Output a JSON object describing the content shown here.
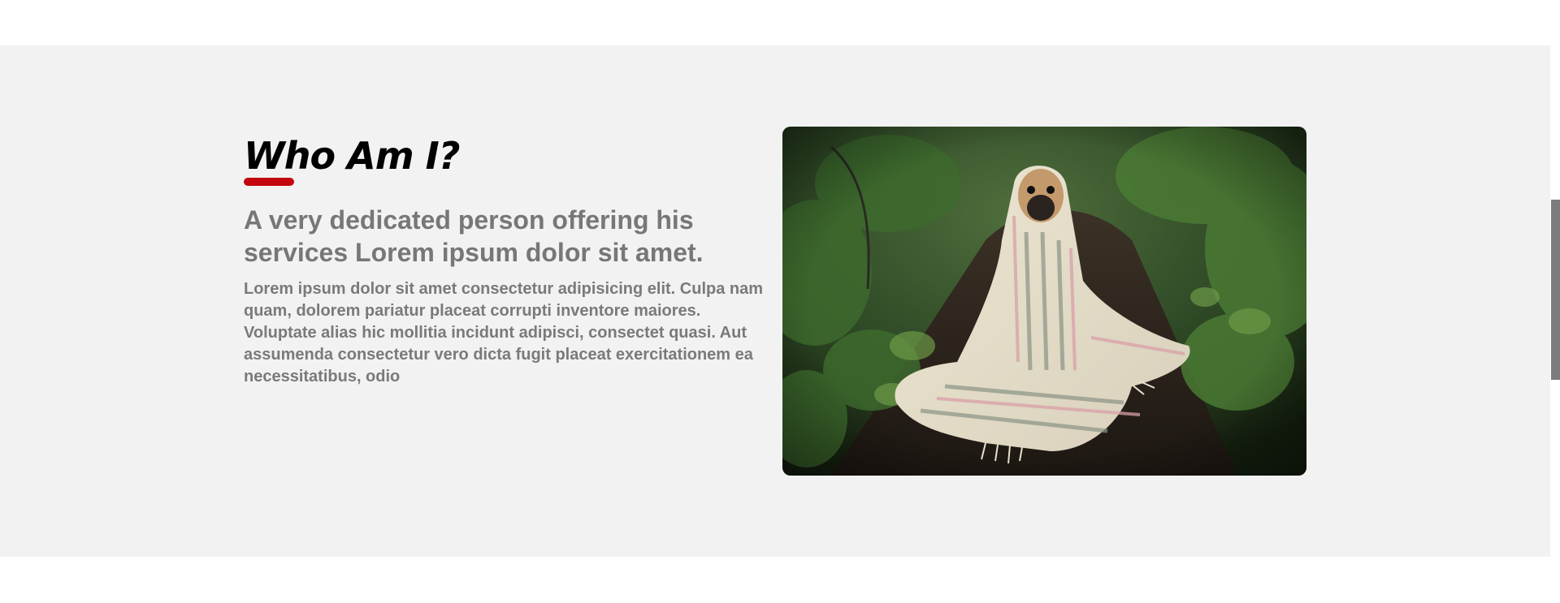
{
  "about": {
    "heading": "Who Am I?",
    "subheading": "A very dedicated person offering his services Lorem ipsum dolor sit amet.",
    "body": "Lorem ipsum dolor sit amet consectetur adipisicing elit. Culpa nam quam, dolorem pariatur placeat corrupti inventore maiores. Voluptate alias hic mollitia incidunt adipisci, consectet quasi. Aut assumenda consectetur vero dicta fugit placeat exercitationem ea necessitatibus, odio",
    "accent_color": "#c4070e",
    "image_icon": "pug-in-blanket-photo"
  },
  "scrollbar": {
    "thumb_color": "#7c7c7c"
  }
}
